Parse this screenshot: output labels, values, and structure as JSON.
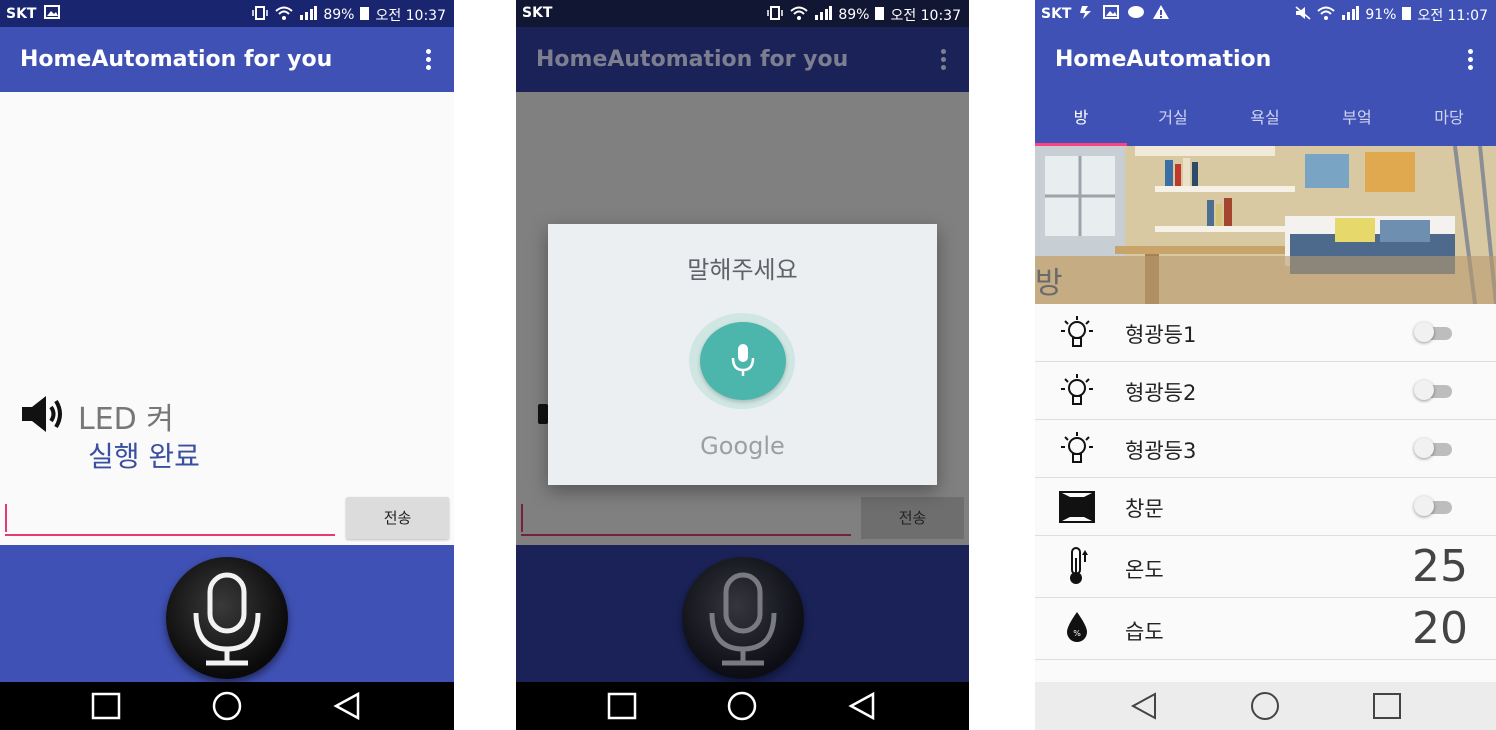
{
  "screens": [
    {
      "status": {
        "carrier": "SKT",
        "battery": "89%",
        "time": "오전 10:37"
      },
      "app_title": "HomeAutomation for you",
      "command_text": "LED 켜",
      "result_text": "실행 완료",
      "send_label": "전송",
      "colors": {
        "primary": "#3f51b5",
        "accent": "#e5397a",
        "status_bar": "#1a2570"
      }
    },
    {
      "status": {
        "carrier": "SKT",
        "battery": "89%",
        "time": "오전 10:37"
      },
      "app_title": "HomeAutomation for you",
      "send_label": "전송",
      "dialog": {
        "prompt": "말해주세요",
        "brand": "Google"
      },
      "colors": {
        "mic": "#4db6ac",
        "dim_primary": "#1a2258"
      }
    },
    {
      "status": {
        "carrier": "SKT",
        "battery": "91%",
        "time": "오전 11:07"
      },
      "app_title": "HomeAutomation",
      "tabs": [
        {
          "label": "방",
          "active": true
        },
        {
          "label": "거실",
          "active": false
        },
        {
          "label": "욕실",
          "active": false
        },
        {
          "label": "부엌",
          "active": false
        },
        {
          "label": "마당",
          "active": false
        }
      ],
      "room_label": "방",
      "devices": [
        {
          "icon": "bulb-icon",
          "label": "형광등1",
          "control": "toggle",
          "on": false
        },
        {
          "icon": "bulb-icon",
          "label": "형광등2",
          "control": "toggle",
          "on": false
        },
        {
          "icon": "bulb-icon",
          "label": "형광등3",
          "control": "toggle",
          "on": false
        },
        {
          "icon": "window-icon",
          "label": "창문",
          "control": "toggle",
          "on": false
        }
      ],
      "sensors": [
        {
          "icon": "thermometer-icon",
          "label": "온도",
          "value": "25"
        },
        {
          "icon": "humidity-icon",
          "label": "습도",
          "value": "20"
        }
      ],
      "colors": {
        "primary": "#3f51b5",
        "tab_indicator": "#ff4081"
      }
    }
  ]
}
